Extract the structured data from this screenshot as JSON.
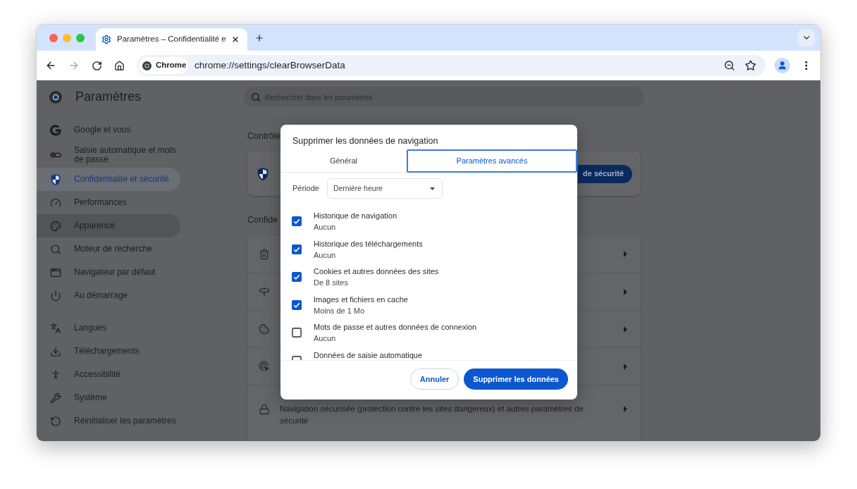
{
  "browser": {
    "tab": {
      "title": "Paramètres – Confidentialité e"
    },
    "toolbar": {
      "back": {
        "disabled": false
      },
      "forward": {
        "disabled": true
      }
    },
    "omnibox": {
      "chip": "Chrome",
      "url": "chrome://settings/clearBrowserData"
    }
  },
  "settings": {
    "title": "Paramètres",
    "search": {
      "placeholder": "Rechercher dans les paramètres"
    },
    "sidebar": {
      "groups": [
        {
          "items": [
            {
              "label": "Google et vous",
              "selected": false,
              "hovered": false
            },
            {
              "label": "Saisie automatique et mots de passe",
              "selected": false,
              "hovered": false
            },
            {
              "label": "Confidentialité et sécurité",
              "selected": true,
              "hovered": false
            },
            {
              "label": "Performances",
              "selected": false,
              "hovered": false
            },
            {
              "label": "Apparence",
              "selected": false,
              "hovered": true
            },
            {
              "label": "Moteur de recherche",
              "selected": false,
              "hovered": false
            },
            {
              "label": "Navigateur par défaut",
              "selected": false,
              "hovered": false
            },
            {
              "label": "Au démarrage",
              "selected": false,
              "hovered": false
            }
          ]
        },
        {
          "items": [
            {
              "label": "Langues",
              "selected": false,
              "hovered": false
            },
            {
              "label": "Téléchargements",
              "selected": false,
              "hovered": false
            },
            {
              "label": "Accessibilité",
              "selected": false,
              "hovered": false
            },
            {
              "label": "Système",
              "selected": false,
              "hovered": false
            },
            {
              "label": "Réinitialiser les paramètres",
              "selected": false,
              "hovered": false
            }
          ]
        }
      ]
    },
    "main": {
      "sections": [
        {
          "kind": "action",
          "heading": "Contrôle",
          "button": "de sécurité"
        },
        {
          "kind": "list",
          "heading": "Confide",
          "rows": [
            {
              "kind": "covered"
            },
            {
              "kind": "covered"
            },
            {
              "kind": "covered"
            },
            {
              "kind": "covered"
            },
            {
              "kind": "text",
              "text": "Navigation sécurisée (protection contre les sites dangereux) et autres paramètres de sécurité"
            }
          ]
        }
      ]
    }
  },
  "dialog": {
    "title": "Supprimer les données de navigation",
    "tabs": [
      {
        "label": "Général",
        "selected": false
      },
      {
        "label": "Paramètres avancés",
        "selected": true
      }
    ],
    "period": {
      "label": "Période",
      "value": "Dernière heure"
    },
    "items": [
      {
        "title": "Historique de navigation",
        "detail": "Aucun",
        "checked": true
      },
      {
        "title": "Historique des téléchargements",
        "detail": "Aucun",
        "checked": true
      },
      {
        "title": "Cookies et autres données des sites",
        "detail": "De 8 sites",
        "checked": true
      },
      {
        "title": "Images et fichiers en cache",
        "detail": "Moins de 1 Mo",
        "checked": true
      },
      {
        "title": "Mots de passe et autres données de connexion",
        "detail": "Aucun",
        "checked": false
      },
      {
        "title": "Données de saisie automatique",
        "checked": false
      }
    ],
    "buttons": [
      {
        "label": "Annuler",
        "kind": "secondary"
      },
      {
        "label": "Supprimer les données",
        "kind": "primary"
      }
    ]
  }
}
